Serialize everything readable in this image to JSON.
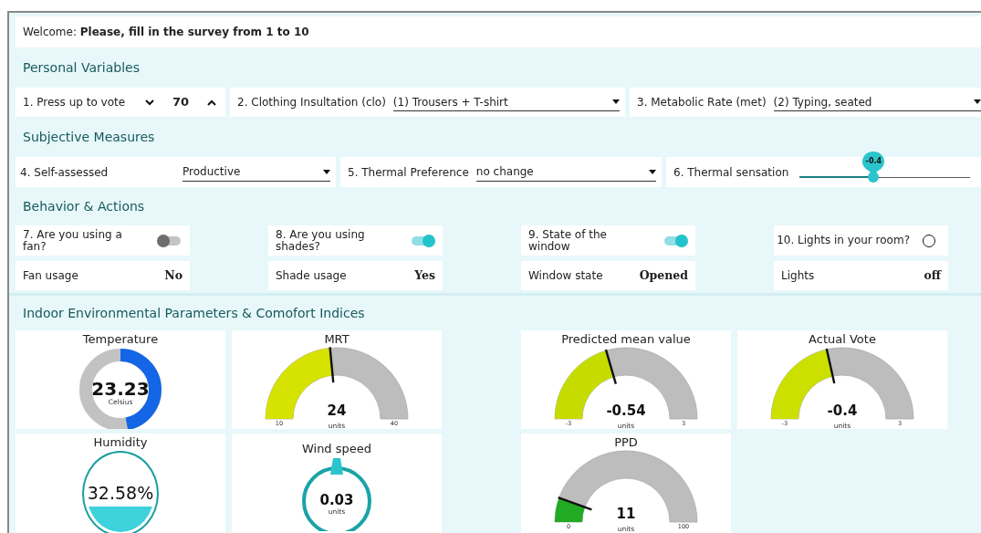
{
  "welcome": "Welcome: **Please, fill in the survey from 1 to 10**",
  "personal": {
    "title": "Personal Variables",
    "vote": {
      "label": "1. Press up to vote",
      "value": "70"
    },
    "clothing": {
      "label": "2. Clothing Insultation (clo)",
      "value": "(1) Trousers + T-shirt"
    },
    "metabolic": {
      "label": "3. Metabolic Rate (met)",
      "value": "(2) Typing, seated"
    }
  },
  "subjective": {
    "title": "Subjective Measures",
    "self_assessed": {
      "label": "4. Self-assessed",
      "value": "Productive"
    },
    "thermal_preference": {
      "label": "5. Thermal Preference",
      "value": "no change"
    },
    "thermal_sensation": {
      "label": "6. Thermal sensation",
      "value": "-0.4",
      "level": 0.435
    }
  },
  "behavior": {
    "title": "Behavior & Actions",
    "questions": [
      {
        "label": "7. Are you using a fan?",
        "kind": "toggle",
        "on": false
      },
      {
        "label": "8. Are you using shades?",
        "kind": "toggle",
        "on": true
      },
      {
        "label": "9. State of the window",
        "kind": "toggle",
        "on": true
      },
      {
        "label": "10. Lights in your room?",
        "kind": "radio",
        "checked": false
      }
    ],
    "statuses": [
      {
        "label": "Fan usage",
        "value": "No"
      },
      {
        "label": "Shade usage",
        "value": "Yes"
      },
      {
        "label": "Window state",
        "value": "Opened"
      },
      {
        "label": "Lights",
        "value": "off"
      }
    ]
  },
  "indoor": {
    "title": "Indoor Environmental Parameters & Comofort Indices",
    "gauges": [
      {
        "kind": "donut",
        "title": "Temperature",
        "value": "23.23",
        "unit": "Celsius",
        "level": 0.47,
        "color": "#1466e6"
      },
      {
        "kind": "semi",
        "title": "MRT",
        "value": "24",
        "unit": "units",
        "min": "10",
        "max": "40",
        "level": 0.47,
        "color": "#d6e200"
      },
      {
        "kind": "semi",
        "title": "Predicted mean value",
        "value": "-0.54",
        "unit": "units",
        "min": "-3",
        "max": "3",
        "level": 0.41,
        "color": "#c6dc00"
      },
      {
        "kind": "semi",
        "title": "Actual Vote",
        "value": "-0.4",
        "unit": "units",
        "min": "-3",
        "max": "3",
        "level": 0.43,
        "color": "#cce000"
      },
      {
        "kind": "liquid",
        "title": "Humidity",
        "value": "32.58%",
        "level": 0.33
      },
      {
        "kind": "dial",
        "title": "Wind speed",
        "value": "0.03",
        "unit": "units"
      },
      {
        "kind": "semi",
        "title": "PPD",
        "value": "11",
        "unit": "units",
        "min": "0",
        "max": "100",
        "level": 0.11,
        "color": "#22aa22"
      }
    ]
  }
}
